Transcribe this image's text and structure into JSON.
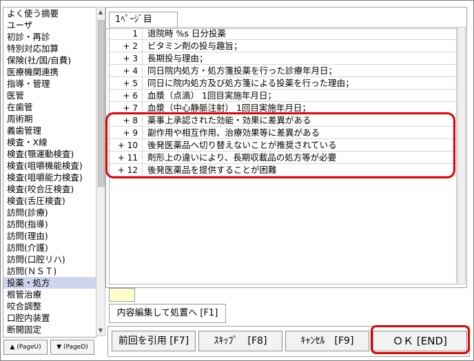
{
  "categories": [
    "よく使う摘要",
    "ユーザ",
    "初診・再診",
    "特別対応加算",
    "保険(社/国/自費)",
    "医療機関連携",
    "指導・管理",
    "医管",
    "在歯管",
    "周術期",
    "義歯管理",
    "検査・X線",
    "検査(顎運動検査)",
    "検査(咀嚼機能検査)",
    "検査(咀嚼能力検査)",
    "検査(咬合圧検査)",
    "検査(舌圧検査)",
    "訪問(診療)",
    "訪問(指導)",
    "訪問(理由)",
    "訪問(介護)",
    "訪問(口腔リハ)",
    "訪問(ＮＳＴ)",
    "投薬・処方",
    "根管治療",
    "咬合調整",
    "口腔内装置",
    "断開固定"
  ],
  "selected_category": "投薬・処方",
  "page_up_label": "▲ (PageU)",
  "page_down_label": "▼ (PageD)",
  "tab_label": "1ﾍﾟｰｼﾞ目",
  "lines": [
    {
      "num": "1",
      "text": "退院時 %s 日分投薬"
    },
    {
      "num": "+ 2",
      "text": "ビタミン剤の投与趣旨；"
    },
    {
      "num": "+ 3",
      "text": "長期投与理由；"
    },
    {
      "num": "+ 4",
      "text": "同日院内処方・処方箋投薬を行った診療年月日；"
    },
    {
      "num": "+ 5",
      "text": "同日に院内処方及び処方箋による投薬を行った理由；"
    },
    {
      "num": "+ 6",
      "text": "血漿（点滴） 1回目実施年月日；"
    },
    {
      "num": "+ 7",
      "text": "血漿（中心静脈注射） 1回目実施年月日；"
    },
    {
      "num": "+ 8",
      "text": "薬事上承認された効能・効果に差異がある"
    },
    {
      "num": "+ 9",
      "text": "副作用や相互作用、治療効果等に差異がある"
    },
    {
      "num": "+ 10",
      "text": "後発医薬品へ切り替えないことが推奨されている"
    },
    {
      "num": "+ 11",
      "text": "剤形上の違いにより、長期収載品の処方等が必要"
    },
    {
      "num": "+ 12",
      "text": "後発医薬品を提供することが困難"
    }
  ],
  "edit_button": "内容編集して処置へ [F1]",
  "buttons": {
    "prev": "前回を引用 [F7]",
    "skip": "ｽｷｯﾌﾟ　[F8]",
    "cancel": "ｷｬﾝｾﾙ　[F9]",
    "ok": "ＯＫ [END]"
  },
  "colors": {
    "selected_bg": "#cfd4ee",
    "highlight": "#e00000",
    "color_swatch": "#ffffcc"
  }
}
